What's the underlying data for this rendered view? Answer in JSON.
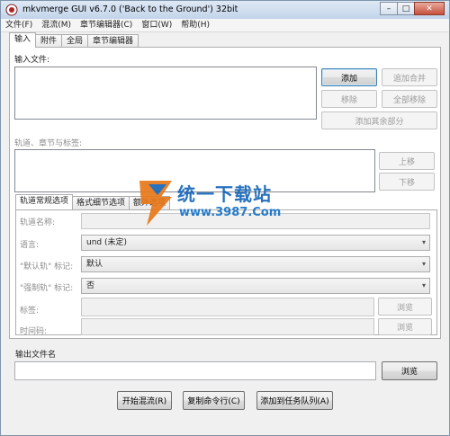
{
  "title_bar": {
    "title": "mkvmerge GUI v6.7.0 ('Back to the Ground') 32bit"
  },
  "window_buttons": {
    "minimize": "–",
    "maximize": "□",
    "close": "✕"
  },
  "menu": [
    "文件(F)",
    "混流(M)",
    "章节编辑器(C)",
    "窗口(W)",
    "帮助(H)"
  ],
  "tabs": [
    "输入",
    "附件",
    "全局",
    "章节编辑器"
  ],
  "input_section": {
    "label": "输入文件:",
    "buttons": {
      "add": "添加",
      "append": "追加合并",
      "remove": "移除",
      "remove_all": "全部移除",
      "add_additional": "添加其余部分"
    }
  },
  "tracks_section": {
    "label": "轨道、章节与标签:",
    "buttons": {
      "up": "上移",
      "down": "下移"
    }
  },
  "subtabs": [
    "轨道常规选项",
    "格式细节选项",
    "额外选项"
  ],
  "general_options": {
    "track_name_label": "轨道名称:",
    "language_label": "语言:",
    "language_value": "und (未定)",
    "default_track_label": "\"默认轨\" 标记:",
    "default_track_value": "默认",
    "forced_track_label": "\"强制轨\" 标记:",
    "forced_track_value": "否",
    "tags_label": "标签:",
    "timecodes_label": "时间码:",
    "browse": "浏览"
  },
  "output": {
    "label": "输出文件名",
    "browse": "浏览"
  },
  "bottom_buttons": {
    "start_mux": "开始混流(R)",
    "copy_cmd": "复制命令行(C)",
    "add_to_queue": "添加到任务队列(A)"
  },
  "watermark": {
    "title": "统一下载站",
    "url": "www.3987.Com"
  },
  "colors": {
    "accent": "#1565b8",
    "title_bar": "#c3d5ea",
    "window_bg": "#f0f0f0"
  }
}
